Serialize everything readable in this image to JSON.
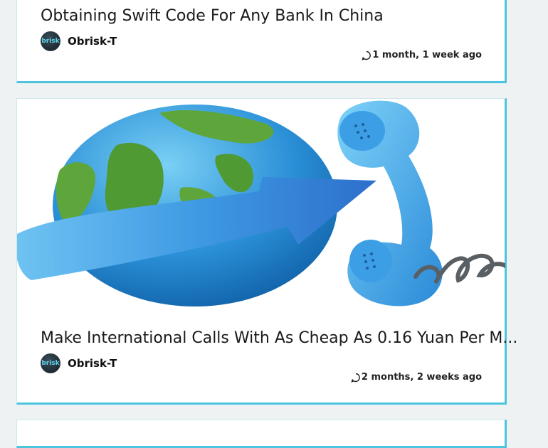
{
  "posts": [
    {
      "title": "Obtaining Swift Code For Any Bank In China",
      "author": "Obrisk-T",
      "avatar_text": "brisk",
      "time": "1 month, 1 week ago"
    },
    {
      "title": "Make International Calls With As Cheap As 0.16 Yuan Per M...",
      "author": "Obrisk-T",
      "avatar_text": "brisk",
      "time": "2 months, 2 weeks ago"
    }
  ],
  "colors": {
    "accent_border": "#4cc4df",
    "background": "#eef2f3"
  }
}
